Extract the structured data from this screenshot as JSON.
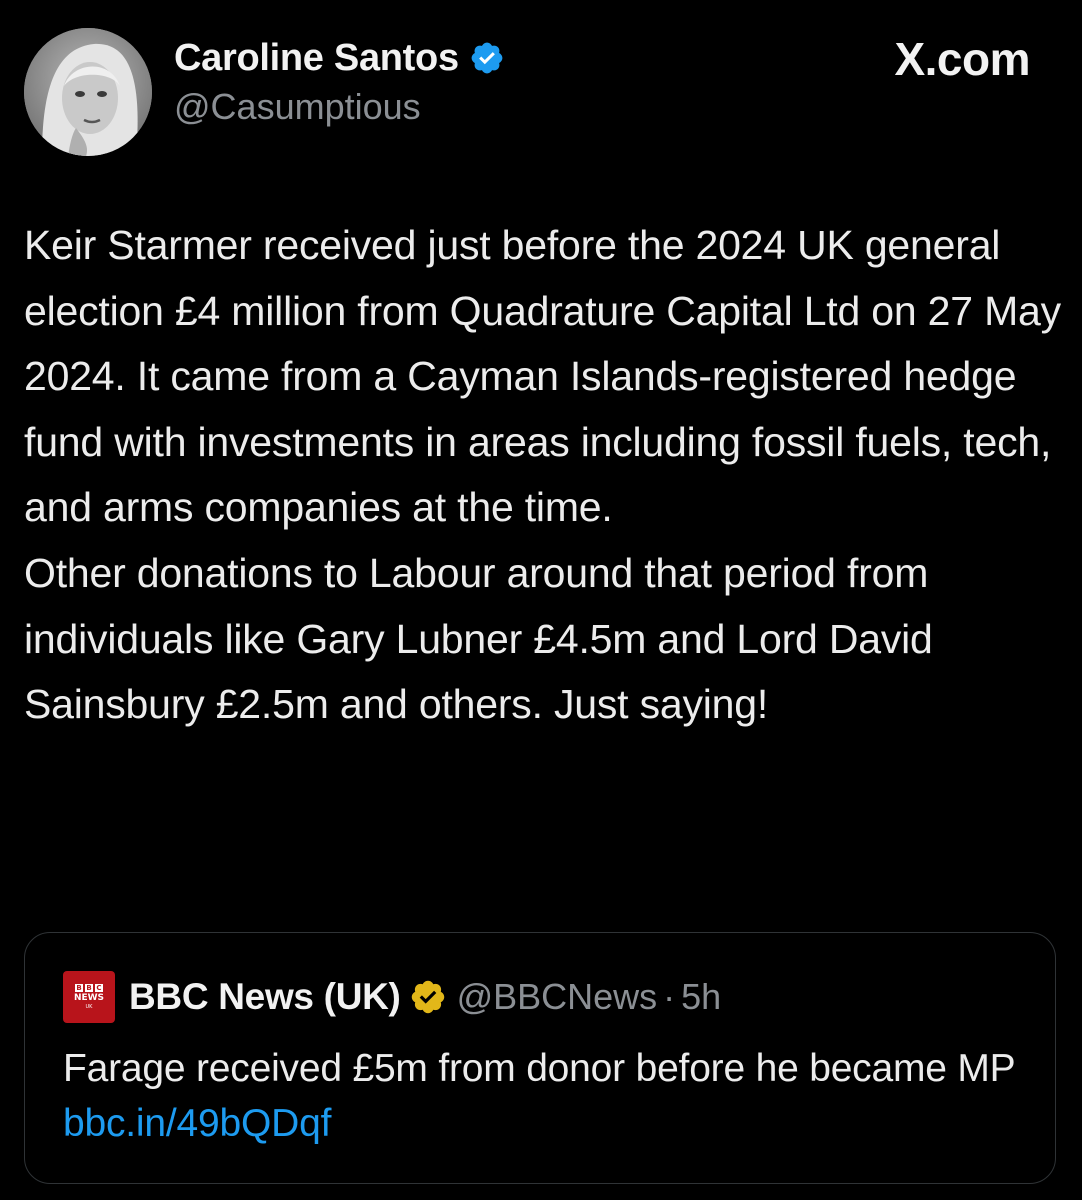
{
  "author": {
    "name": "Caroline Santos",
    "handle": "@Casumptious",
    "avatar_icon": "profile-photo"
  },
  "site_label": "X.com",
  "tweet": {
    "paragraph_1": "Keir Starmer received just before the 2024 UK general election £4 million from Quadrature Capital Ltd on 27 May 2024. It came from a Cayman Islands-registered hedge fund with investments in areas including fossil fuels, tech, and arms companies at the time.",
    "paragraph_2": "Other donations to Labour around that period from individuals like Gary Lubner £4.5m and Lord David Sainsbury £2.5m and others. Just saying!"
  },
  "quote": {
    "logo_blocks": [
      "B",
      "B",
      "C"
    ],
    "logo_line_1": "NEWS",
    "logo_line_2": "UK",
    "name": "BBC News (UK)",
    "handle": "@BBCNews",
    "separator": "·",
    "time": "5h",
    "text": "Farage received £5m from donor before he became MP",
    "link": "bbc.in/49bQDqf"
  },
  "colors": {
    "background": "#000000",
    "verified_blue": "#1d9bf0",
    "verified_gold": "#e2b719",
    "link": "#1d9bf0",
    "bbc_red": "#b8141b"
  }
}
